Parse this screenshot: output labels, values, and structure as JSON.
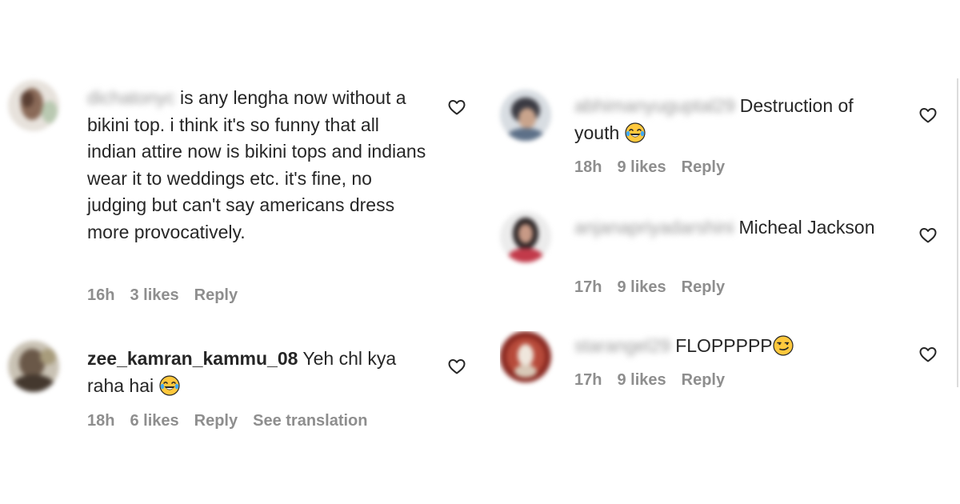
{
  "comments_left": [
    {
      "username": "dichatonyc",
      "text": "is any lengha now without a bikini top. i think it's so funny that all indian attire now is bikini tops and indians wear it to weddings etc. it's fine, no judging but can't say americans dress more provocatively.",
      "time": "16h",
      "likes": "3 likes",
      "reply": "Reply"
    },
    {
      "username": "zee_kamran_kammu_08",
      "text": "Yeh chl kya raha hai",
      "emoji": "face-with-tears-of-joy",
      "time": "18h",
      "likes": "6 likes",
      "reply": "Reply",
      "translation": "See translation"
    }
  ],
  "comments_right": [
    {
      "username": "abhimanyuguptal29",
      "text": "Destruction of youth",
      "emoji": "face-with-tears-of-joy",
      "time": "18h",
      "likes": "9 likes",
      "reply": "Reply"
    },
    {
      "username": "anjanapriyadarshini",
      "text": "Micheal Jackson",
      "time": "17h",
      "likes": "9 likes",
      "reply": "Reply"
    },
    {
      "username": "starangel29",
      "text": "FLOPPPPP",
      "emoji": "smirking-face",
      "time": "17h",
      "likes": "9 likes",
      "reply": "Reply"
    }
  ],
  "colors": {
    "text": "#262626",
    "meta": "#8e8e8e",
    "emoji_face": "#FFC83D"
  }
}
